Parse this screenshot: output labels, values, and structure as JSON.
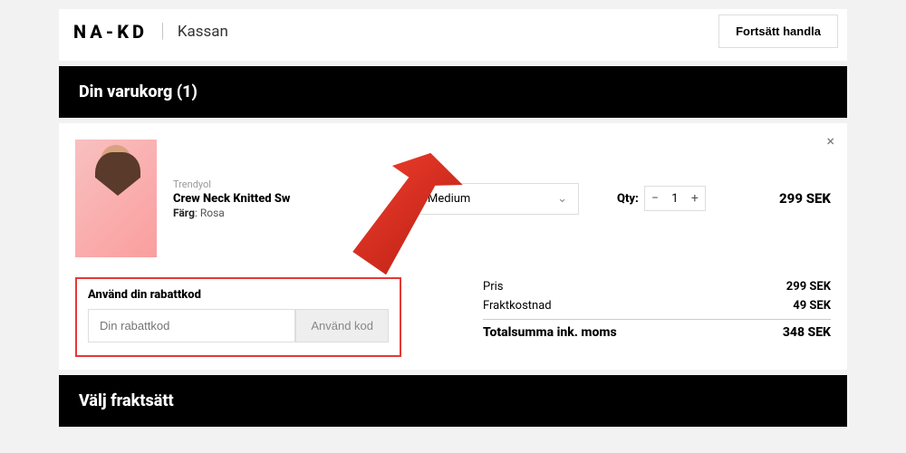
{
  "header": {
    "brand": "NA-KD",
    "page_label": "Kassan",
    "continue_shopping": "Fortsätt handla"
  },
  "cart_section_title": "Din varukorg (1)",
  "cart_item": {
    "brand": "Trendyol",
    "name": "Crew Neck Knitted Sw",
    "color_label": "Färg",
    "color_value": "Rosa",
    "size_selected": "Medium",
    "qty_label": "Qty:",
    "qty_value": "1",
    "price": "299 SEK"
  },
  "promo": {
    "title": "Använd din rabattkod",
    "placeholder": "Din rabattkod",
    "apply_label": "Använd kod"
  },
  "summary": {
    "price_label": "Pris",
    "price_value": "299 SEK",
    "shipping_label": "Fraktkostnad",
    "shipping_value": "49 SEK",
    "total_label": "Totalsumma ink. moms",
    "total_value": "348 SEK"
  },
  "shipping_section_title": "Välj fraktsätt"
}
